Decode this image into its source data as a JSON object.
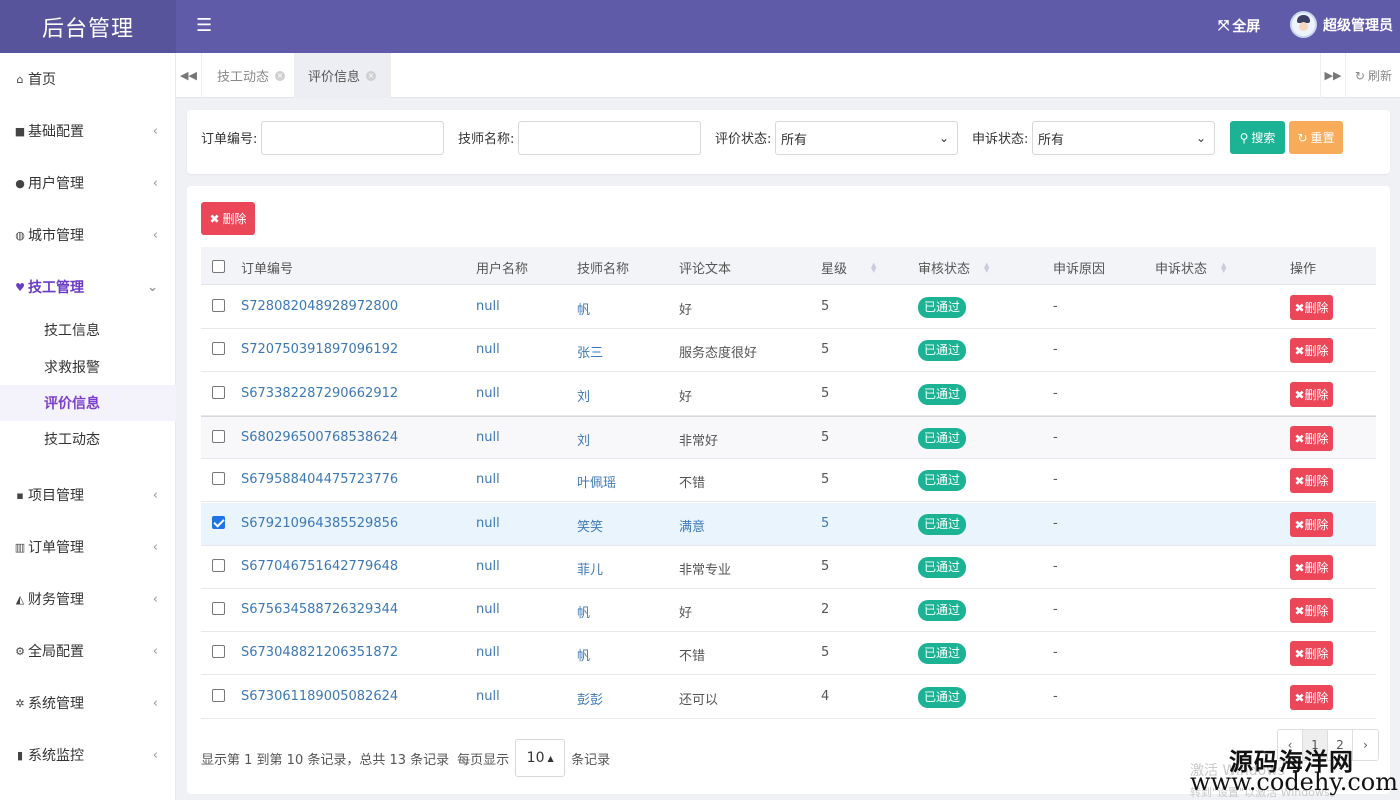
{
  "app": {
    "brand": "后台管理",
    "fullscreen_label": "全屏",
    "user_name": "超级管理员"
  },
  "sidebar": {
    "items": [
      {
        "label": "首页",
        "icon": "home-icon"
      },
      {
        "label": "基础配置",
        "icon": "bookmark-icon"
      },
      {
        "label": "用户管理",
        "icon": "user-icon"
      },
      {
        "label": "城市管理",
        "icon": "globe-icon"
      },
      {
        "label": "技工管理",
        "icon": "heart-icon"
      },
      {
        "label": "项目管理",
        "icon": "book-icon"
      },
      {
        "label": "订单管理",
        "icon": "bar-chart-icon"
      },
      {
        "label": "财务管理",
        "icon": "area-chart-icon"
      },
      {
        "label": "全局配置",
        "icon": "gears-icon"
      },
      {
        "label": "系统管理",
        "icon": "gear-icon"
      },
      {
        "label": "系统监控",
        "icon": "video-camera-icon"
      }
    ],
    "subitems": [
      "技工信息",
      "求救报警",
      "评价信息",
      "技工动态"
    ]
  },
  "tabs": {
    "items": [
      "技工动态",
      "评价信息"
    ],
    "refresh_label": "刷新"
  },
  "search": {
    "order_no_label": "订单编号:",
    "tech_name_label": "技师名称:",
    "review_status_label": "评价状态:",
    "review_status_value": "所有",
    "appeal_status_label": "申诉状态:",
    "appeal_status_value": "所有",
    "search_label": "搜索",
    "reset_label": "重置"
  },
  "table": {
    "delete_label": "删除",
    "headers": [
      "订单编号",
      "用户名称",
      "技师名称",
      "评论文本",
      "星级",
      "审核状态",
      "申诉原因",
      "申诉状态",
      "操作"
    ],
    "rows": [
      {
        "order": "S728082048928972800",
        "user": "null",
        "tech": "帆",
        "text": "好",
        "stars": "5",
        "status": "已通过",
        "reason": "-",
        "checked": false
      },
      {
        "order": "S720750391897096192",
        "user": "null",
        "tech": "张三",
        "text": "服务态度很好",
        "stars": "5",
        "status": "已通过",
        "reason": "-",
        "checked": false
      },
      {
        "order": "S673382287290662912",
        "user": "null",
        "tech": "刘",
        "text": "好",
        "stars": "5",
        "status": "已通过",
        "reason": "-",
        "checked": false
      },
      {
        "order": "S680296500768538624",
        "user": "null",
        "tech": "刘",
        "text": "非常好",
        "stars": "5",
        "status": "已通过",
        "reason": "-",
        "checked": false
      },
      {
        "order": "S679588404475723776",
        "user": "null",
        "tech": "叶佩瑶",
        "text": "不错",
        "stars": "5",
        "status": "已通过",
        "reason": "-",
        "checked": false
      },
      {
        "order": "S679210964385529856",
        "user": "null",
        "tech": "笑笑",
        "text": "满意",
        "stars": "5",
        "status": "已通过",
        "reason": "-",
        "checked": true
      },
      {
        "order": "S677046751642779648",
        "user": "null",
        "tech": "菲儿",
        "text": "非常专业",
        "stars": "5",
        "status": "已通过",
        "reason": "-",
        "checked": false
      },
      {
        "order": "S675634588726329344",
        "user": "null",
        "tech": "帆",
        "text": "好",
        "stars": "2",
        "status": "已通过",
        "reason": "-",
        "checked": false
      },
      {
        "order": "S673048821206351872",
        "user": "null",
        "tech": "帆",
        "text": "不错",
        "stars": "5",
        "status": "已通过",
        "reason": "-",
        "checked": false
      },
      {
        "order": "S673061189005082624",
        "user": "null",
        "tech": "彭彭",
        "text": "还可以",
        "stars": "4",
        "status": "已通过",
        "reason": "-",
        "checked": false
      }
    ],
    "row_delete_label": "删除"
  },
  "pagination": {
    "info_text": "显示第 1 到第 10 条记录，总共 13 条记录",
    "per_page_prefix": "每页显示",
    "per_page_value": "10",
    "per_page_suffix": "条记录",
    "pages": [
      "‹",
      "1",
      "2",
      "›"
    ]
  },
  "watermark": {
    "title": "源码海洋网",
    "url": "www.codehy.com",
    "faint_line1": "激活 Windows",
    "faint_line2": "转到\"设置\"以激活 Windows。"
  }
}
